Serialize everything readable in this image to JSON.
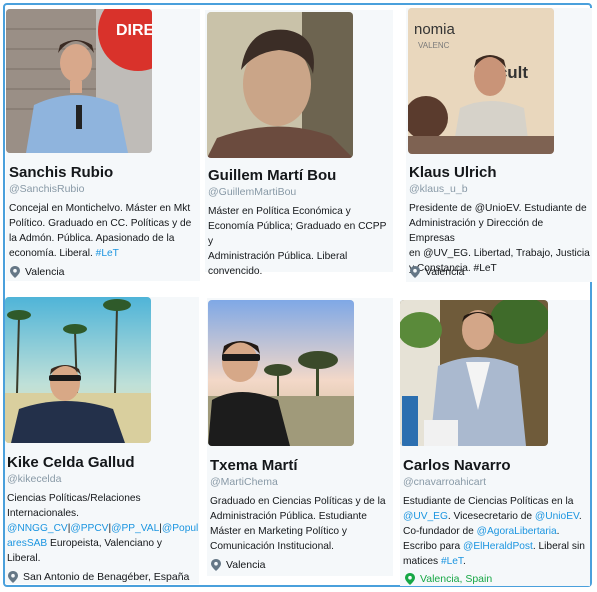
{
  "profiles": [
    {
      "name": "Sanchis Rubio",
      "handle": "@SanchisRubio",
      "bio": [
        "Concejal en Montichelvo. Máster en Mkt",
        "Político. Graduado en CC. Políticas y de",
        "la Admón. Pública. Apasionado de la",
        "economía. Liberal. ",
        "#LeT"
      ],
      "location": "Valencia",
      "photo_text": "DIRE"
    },
    {
      "name": "Guillem Martí Bou",
      "handle": "@GuillemMartiBou",
      "bio": [
        "Máster en Política Económica y",
        "Economía Pública; Graduado en CCPP y",
        "Administración Pública. Liberal",
        "convencido."
      ],
      "location": ""
    },
    {
      "name": "Klaus Ulrich",
      "handle": "@klaus_u_b",
      "bio_line1a": "Presidente de ",
      "bio_line1b": "@UnioEV",
      "bio_line1c": ". Estudiante de",
      "bio_line2": "Administración y Dirección de Empresas",
      "bio_line3a": "en ",
      "bio_line3b": "@UV_EG",
      "bio_line3c": ". Libertad, Trabajo, Justicia",
      "bio_line4": "y Constancia. #LeT",
      "location": "Valencia",
      "photo_text_a": "nomia",
      "photo_text_b": "Facult",
      "photo_text_c": "VALENC"
    },
    {
      "name": "Kike Celda Gallud",
      "handle": "@kikecelda",
      "bio_line1": "Ciencias Políticas/Relaciones",
      "bio_line2": "Internacionales.",
      "bio_line3a": "@NNGG_CV",
      "bio_line3b": "|",
      "bio_line3c": "@PPCV",
      "bio_line3d": "|",
      "bio_line3e": "@PP_VAL",
      "bio_line3f": "|",
      "bio_line3g": "@Popul",
      "bio_line4a": "aresSAB",
      "bio_line4b": " Europeista, Valenciano y",
      "bio_line5": "Liberal.",
      "location": "San Antonio de Benagéber, España"
    },
    {
      "name": "Txema Martí",
      "handle": "@MartiChema",
      "bio": [
        "Graduado en Ciencias Políticas y de la",
        "Administración Pública. Estudiante",
        "Máster en Marketing Político y",
        "Comunicación Institucional."
      ],
      "location": "Valencia"
    },
    {
      "name": "Carlos Navarro",
      "handle": "@cnavarroahicart",
      "bio_line1": "Estudiante de Ciencias Políticas en la",
      "bio_line2a": "@UV_EG",
      "bio_line2b": ". Vicesecretario de ",
      "bio_line2c": "@UnioEV",
      "bio_line2d": ".",
      "bio_line3a": "Co-fundador de ",
      "bio_line3b": "@AgoraLibertaria",
      "bio_line3c": ".",
      "bio_line4a": "Escribo para ",
      "bio_line4b": "@ElHeraldPost",
      "bio_line4c": ". Liberal sin",
      "bio_line5a": "matices ",
      "bio_line5b": "#LeT",
      "bio_line5c": ".",
      "location": "Valencia, Spain"
    }
  ],
  "colors": {
    "link": "#1b95e0",
    "text": "#14171a",
    "muted": "#8899a6",
    "location_green": "#17a745",
    "frame_border": "#4aa0dc"
  },
  "icons": {
    "location": "location-pin-icon"
  }
}
